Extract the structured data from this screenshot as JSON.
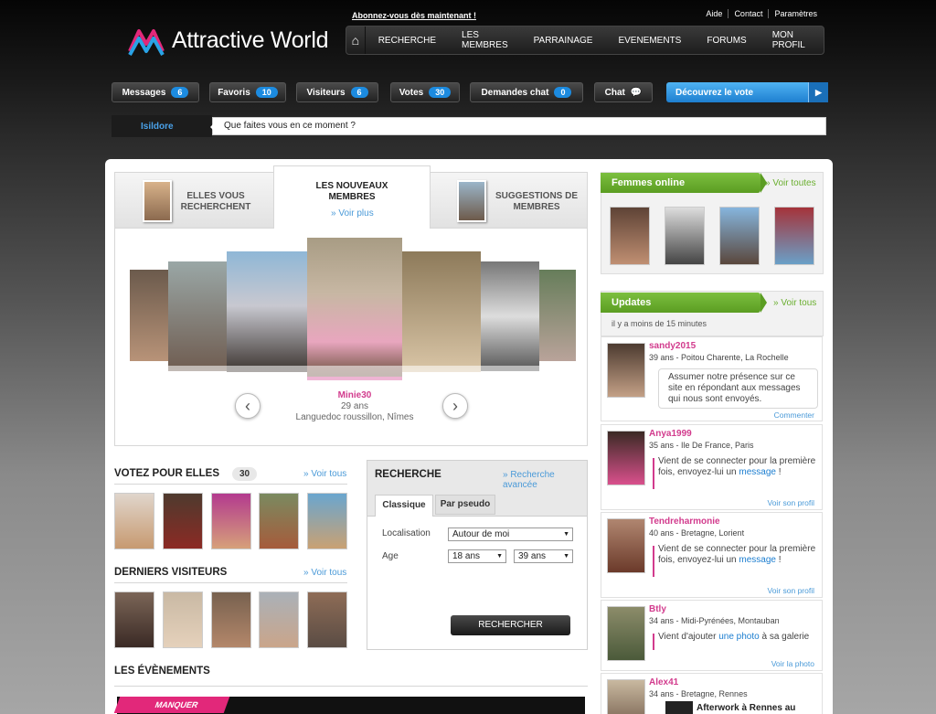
{
  "brand": {
    "name": "Attractive World"
  },
  "header": {
    "subscribe": "Abonnez-vous dès maintenant !",
    "links": [
      "Aide",
      "Contact",
      "Paramètres"
    ]
  },
  "nav": [
    "RECHERCHE",
    "LES MEMBRES",
    "PARRAINAGE",
    "EVENEMENTS",
    "FORUMS",
    "MON PROFIL"
  ],
  "toolbar": [
    {
      "label": "Messages",
      "count": "6"
    },
    {
      "label": "Favoris",
      "count": "10"
    },
    {
      "label": "Visiteurs",
      "count": "6"
    },
    {
      "label": "Votes",
      "count": "30"
    },
    {
      "label": "Demandes chat",
      "count": "0"
    },
    {
      "label": "Chat",
      "count": ""
    }
  ],
  "vote_cta": "Découvrez le vote",
  "status": {
    "user": "Isildore",
    "placeholder": "Que faites vous en ce moment ?"
  },
  "tabs": {
    "left": "ELLES VOUS RECHERCHENT",
    "center": "LES NOUVEAUX MEMBRES",
    "center_link": "» Voir plus",
    "right": "SUGGESTIONS DE MEMBRES"
  },
  "featured": {
    "name": "Minie30",
    "age": "29 ans",
    "location": "Languedoc roussillon, Nîmes"
  },
  "votez": {
    "title": "VOTEZ POUR ELLES",
    "count": "30",
    "link": "» Voir tous"
  },
  "visiteurs": {
    "title": "DERNIERS VISITEURS",
    "link": "» Voir tous"
  },
  "events": {
    "title": "LES ÉVÈNEMENTS",
    "banner": "MANQUER"
  },
  "search": {
    "title": "RECHERCHE",
    "advanced": "» Recherche avancée",
    "tab_classic": "Classique",
    "tab_pseudo": "Par pseudo",
    "loc_label": "Localisation",
    "loc_value": "Autour de moi",
    "age_label": "Age",
    "age_min": "18 ans",
    "age_max": "39 ans",
    "button": "RECHERCHER"
  },
  "online": {
    "title": "Femmes online",
    "link": "» Voir toutes"
  },
  "updates": {
    "title": "Updates",
    "link": "» Voir tous",
    "time": "il y a moins de 15 minutes",
    "items": [
      {
        "name": "sandy2015",
        "meta": "39 ans - Poitou Charente, La Rochelle",
        "msg": "Assumer notre présence sur ce site en répondant aux messages qui nous sont envoyés.",
        "link": "Commenter"
      },
      {
        "name": "Anya1999",
        "meta": "35 ans - Ile De France, Paris",
        "msg": "Vient de se connecter pour la première fois, envoyez-lui un",
        "msg_link": "message",
        "msg_end": " !",
        "link": "Voir son profil"
      },
      {
        "name": "Tendreharmonie",
        "meta": "40 ans - Bretagne, Lorient",
        "msg": "Vient de se connecter pour la première fois, envoyez-lui un",
        "msg_link": "message",
        "msg_end": " !",
        "link": "Voir son profil"
      },
      {
        "name": "Btly",
        "meta": "34 ans - Midi-Pyrénées, Montauban",
        "msg": "Vient d'ajouter",
        "msg_link": "une photo",
        "msg_end": " à sa galerie",
        "link": "Voir la photo"
      },
      {
        "name": "Alex41",
        "meta": "34 ans - Bretagne, Rennes",
        "msg": "Afterwork à Rennes au"
      }
    ]
  },
  "colors": {
    "accent_blue": "#1c8be0",
    "accent_green": "#6aaf2f",
    "accent_pink": "#d23b8d"
  }
}
